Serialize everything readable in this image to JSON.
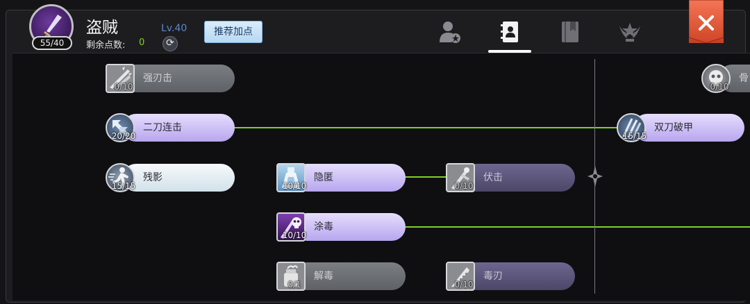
{
  "header": {
    "class_name": "盗贼",
    "avatar_count": "55/40",
    "points_label": "剩余点数:",
    "points_value": "0",
    "level": "Lv.40",
    "recommend_label": "推荐加点",
    "refresh_icon": "refresh-icon",
    "tabs": [
      {
        "icon": "user-star-icon",
        "active": false
      },
      {
        "icon": "contact-book-icon",
        "active": true
      },
      {
        "icon": "bookmark-book-icon",
        "active": false
      },
      {
        "icon": "wing-star-badge-icon",
        "active": false
      }
    ],
    "close_icon": "close-icon",
    "colors": {
      "accent_green": "#7ed321",
      "close_red": "#e05535",
      "level_blue": "#5d86c8"
    }
  },
  "skills": [
    {
      "id": "s1",
      "name": "强刃击",
      "count": "0/10",
      "state": "locked"
    },
    {
      "id": "s2",
      "name": "二刀连击",
      "count": "20/20",
      "state": "maxed"
    },
    {
      "id": "s3",
      "name": "残影",
      "count": "15/15",
      "state": "maxed"
    },
    {
      "id": "s4",
      "name": "隐匿",
      "count": "10/10",
      "state": "maxed"
    },
    {
      "id": "s5",
      "name": "伏击",
      "count": "0/10",
      "state": "available"
    },
    {
      "id": "s6",
      "name": "涂毒",
      "count": "10/10",
      "state": "maxed"
    },
    {
      "id": "s7",
      "name": "解毒",
      "count": "0/1",
      "state": "locked"
    },
    {
      "id": "s8",
      "name": "毒刃",
      "count": "0/10",
      "state": "available"
    },
    {
      "id": "s9",
      "name": "双刀破甲",
      "count": "15/15",
      "state": "maxed"
    },
    {
      "id": "s10",
      "name": "骨",
      "count": "0/10",
      "state": "locked"
    }
  ]
}
